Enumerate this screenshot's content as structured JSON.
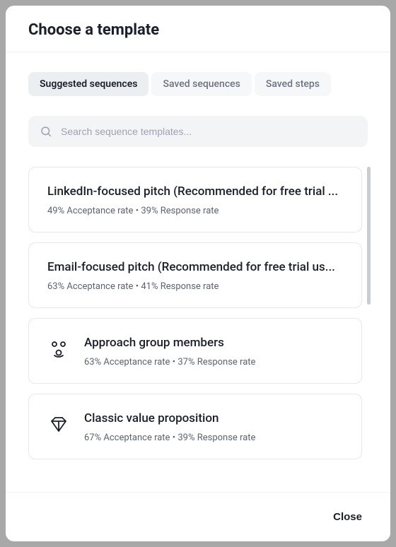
{
  "modal": {
    "title": "Choose a template"
  },
  "tabs": [
    {
      "label": "Suggested sequences",
      "active": true
    },
    {
      "label": "Saved sequences",
      "active": false
    },
    {
      "label": "Saved steps",
      "active": false
    }
  ],
  "search": {
    "placeholder": "Search sequence templates..."
  },
  "templates": [
    {
      "title": "LinkedIn-focused pitch (Recommended for free trial ...",
      "acceptance": "49%",
      "response": "39%",
      "icon": null
    },
    {
      "title": "Email-focused pitch (Recommended for free trial us...",
      "acceptance": "63%",
      "response": "41%",
      "icon": null
    },
    {
      "title": "Approach group members",
      "acceptance": "63%",
      "response": "37%",
      "icon": "group"
    },
    {
      "title": "Classic value proposition",
      "acceptance": "67%",
      "response": "39%",
      "icon": "diamond"
    }
  ],
  "stats_labels": {
    "acceptance": "Acceptance rate",
    "response": "Response rate",
    "separator": " • "
  },
  "footer": {
    "close": "Close"
  }
}
